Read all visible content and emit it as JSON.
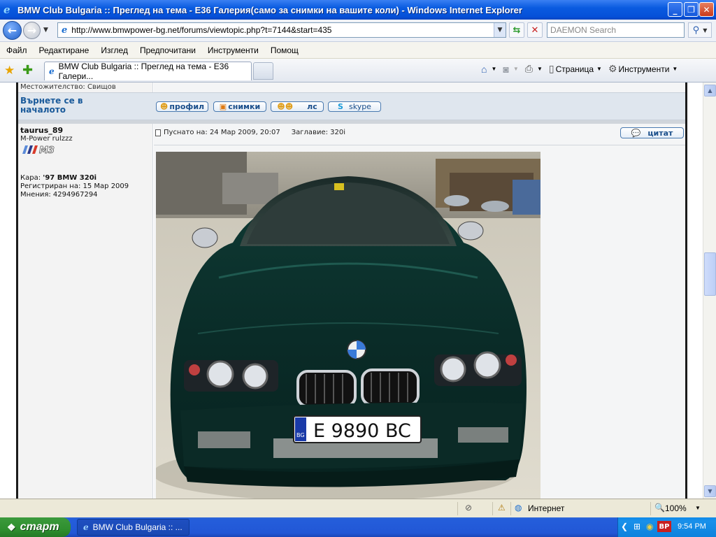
{
  "window": {
    "title": "BMW Club Bulgaria :: Преглед на тема - E36 Галерия(само за снимки на вашите коли) - Windows Internet Explorer"
  },
  "address_bar": {
    "url": "http://www.bmwpower-bg.net/forums/viewtopic.php?t=7144&start=435",
    "search_placeholder": "DAEMON Search"
  },
  "menu": [
    "Файл",
    "Редактиране",
    "Изглед",
    "Предпочитани",
    "Инструменти",
    "Помощ"
  ],
  "tab": {
    "title": "BMW Club Bulgaria :: Преглед на тема - E36 Галери..."
  },
  "command_bar": {
    "page_label": "Страница",
    "tools_label": "Инструменти"
  },
  "forum": {
    "prev_location": "Местожителство: Свищов",
    "back_to_top": "Върнете се в началото",
    "buttons": {
      "profile": "профил",
      "photos": "снимки",
      "pm": "лс",
      "skype": "skype",
      "quote": "цитат"
    },
    "post": {
      "author": "taurus_89",
      "rank": "M-Power rulzzz",
      "badge": "M3",
      "car_label": "Кара:",
      "car_value": "'97 BMW 320i",
      "registered": "Регистриран на: 15 Мар 2009",
      "posts": "Мнения: 4294967294",
      "posted_on": "Пуснато на: 24 Мар 2009, 20:07",
      "subject": "Заглавие: 320i",
      "photo": {
        "plate_country": "BG",
        "plate_text": "E 9890 BC"
      }
    }
  },
  "statusbar": {
    "zone": "Интернет",
    "zoom": "100%"
  },
  "taskbar": {
    "start_label": "старт",
    "window_button": "BMW Club Bulgaria :: ...",
    "lang": "BP",
    "clock": "9:54 PM"
  },
  "colors": {
    "link": "#1a5a9a",
    "titlebar": "#0550d8",
    "taskbar": "#245edb",
    "start": "#2f8f2f"
  },
  "icons": [
    "ie-icon",
    "back-arrow-icon",
    "forward-arrow-icon",
    "refresh-icon",
    "stop-icon",
    "search-icon",
    "favorites-star-icon",
    "add-favorites-icon",
    "home-icon",
    "rss-icon",
    "print-icon",
    "page-icon",
    "gear-icon",
    "doc-icon",
    "security-icon",
    "internet-globe-icon",
    "zoom-icon",
    "windows-flag-icon"
  ]
}
